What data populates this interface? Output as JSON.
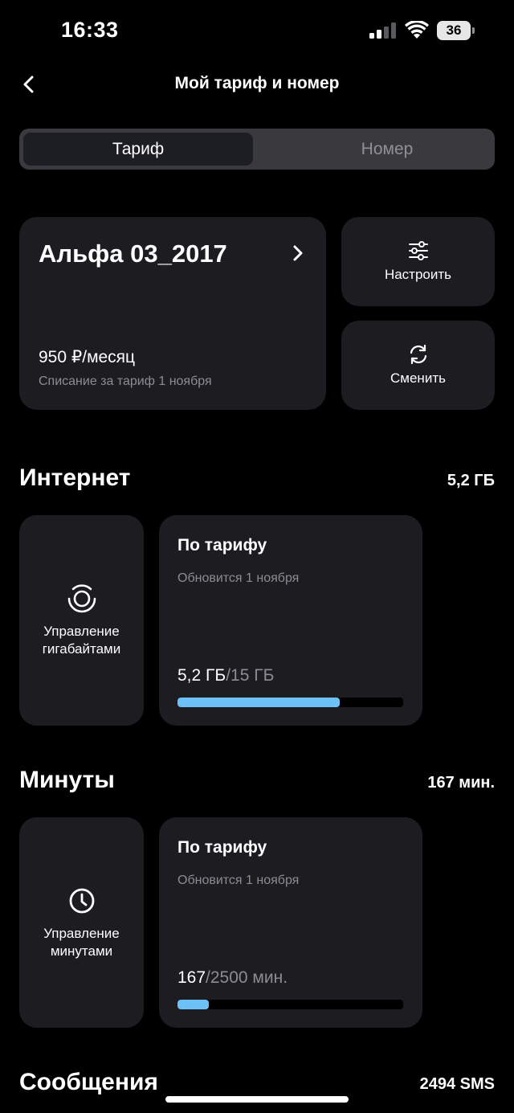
{
  "status_bar": {
    "time": "16:33",
    "battery": "36"
  },
  "header": {
    "title": "Мой тариф и номер"
  },
  "tabs": [
    {
      "label": "Тариф",
      "active": true
    },
    {
      "label": "Номер",
      "active": false
    }
  ],
  "tariff": {
    "name": "Альфа 03_2017",
    "price": "950 ₽/месяц",
    "note": "Списание за тариф 1 ноября"
  },
  "actions": {
    "configure_label": "Настроить",
    "change_label": "Сменить"
  },
  "internet": {
    "title": "Интернет",
    "total": "5,2 ГБ",
    "manage_label_line1": "Управление",
    "manage_label_line2": "гигабайтами",
    "plan_title": "По тарифу",
    "plan_note": "Обновится 1 ноября",
    "used": "5,2 ГБ",
    "limit": "/15 ГБ",
    "progress_fraction": 0.72
  },
  "minutes": {
    "title": "Минуты",
    "total": "167 мин.",
    "manage_label_line1": "Управление",
    "manage_label_line2": "минутами",
    "plan_title": "По тарифу",
    "plan_note": "Обновится 1 ноября",
    "used": "167",
    "limit": "/2500 мин.",
    "progress_fraction": 0.14
  },
  "messages": {
    "title": "Сообщения",
    "total": "2494 SMS"
  },
  "colors": {
    "background": "#000000",
    "card": "#1c1c21",
    "progress": "#6cc2f6",
    "muted_text": "#8c8c92"
  }
}
